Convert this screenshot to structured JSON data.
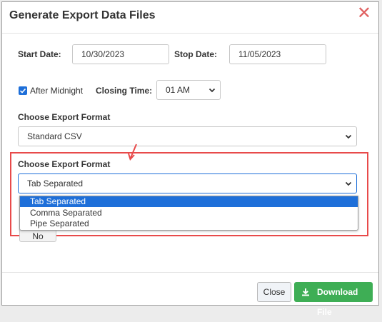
{
  "dialog": {
    "title": "Generate Export Data Files",
    "close_glyph": "✕"
  },
  "dates": {
    "start_label": "Start Date:",
    "start_value": "10/30/2023",
    "stop_label": "Stop Date:",
    "stop_value": "11/05/2023"
  },
  "options": {
    "after_midnight_label": "After Midnight",
    "after_midnight_checked": true,
    "closing_time_label": "Closing Time:",
    "closing_time_value": "01 AM"
  },
  "export_format": {
    "label": "Choose Export Format",
    "value": "Standard CSV"
  },
  "delimiter": {
    "label": "Choose Export Format",
    "value": "Tab Separated",
    "options": [
      "Tab Separated",
      "Comma Separated",
      "Pipe Separated"
    ],
    "selected_index": 0
  },
  "partially_hidden_button": {
    "label": "No"
  },
  "footer": {
    "close_label": "Close",
    "download_label": "Download File"
  },
  "colors": {
    "accent_blue": "#1e6fd9",
    "download_green": "#3eae55",
    "highlight_red": "#e84a4a"
  },
  "icons": {
    "close": "close-icon",
    "checkbox": "checkmark-icon",
    "chevron": "chevron-down-icon",
    "download": "download-icon",
    "annotation": "annotation-arrow-icon"
  }
}
